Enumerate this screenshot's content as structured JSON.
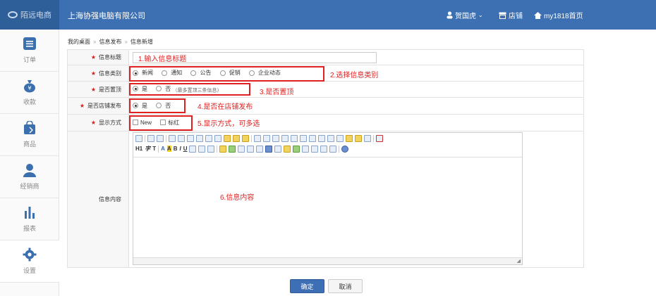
{
  "header": {
    "logo_text": "陌远电商",
    "company": "上海协强电脑有限公司",
    "user": "贺国虎",
    "store_label": "店铺",
    "home_label": "my1818首页"
  },
  "sidebar": {
    "items": [
      {
        "label": "订单",
        "icon": "order-list-icon"
      },
      {
        "label": "收款",
        "icon": "money-bag-icon"
      },
      {
        "label": "商品",
        "icon": "shopping-bag-icon"
      },
      {
        "label": "经销商",
        "icon": "person-icon"
      },
      {
        "label": "报表",
        "icon": "bar-chart-icon"
      },
      {
        "label": "设置",
        "icon": "gear-icon"
      }
    ],
    "active_index": 5
  },
  "breadcrumb": [
    "我的桌面",
    "信息发布",
    "信息新增"
  ],
  "form": {
    "title": {
      "label": "信息标题",
      "value": ""
    },
    "category": {
      "label": "信息类别",
      "options": [
        "新闻",
        "通知",
        "公告",
        "促销",
        "企业动态"
      ],
      "selected": 0
    },
    "top": {
      "label": "是否置顶",
      "yes": "是",
      "no": "否",
      "hint": "（最多置顶三条信息）",
      "selected": "yes"
    },
    "store": {
      "label": "是否店铺发布",
      "yes": "是",
      "no": "否",
      "selected": "yes"
    },
    "display": {
      "label": "显示方式",
      "options": [
        "New",
        "标红"
      ]
    },
    "content": {
      "label": "信息内容",
      "value": ""
    }
  },
  "annotations": {
    "a1": "1.输入信息标题",
    "a2": "2.选择信息类别",
    "a3": "3.是否置顶",
    "a4": "4.是否在店铺发布",
    "a5": "5.显示方式，可多选",
    "a6": "6.信息内容"
  },
  "editor": {
    "heading_label": "H1",
    "font_label": "字",
    "size_label": "T",
    "font_color_label": "A",
    "bg_color_label": "A",
    "bold_label": "B",
    "italic_label": "I",
    "underline_label": "U"
  },
  "buttons": {
    "ok": "确定",
    "cancel": "取消"
  },
  "colors": {
    "brand": "#3c70b2",
    "annotation": "#e02020",
    "required": "#d31a1a"
  }
}
